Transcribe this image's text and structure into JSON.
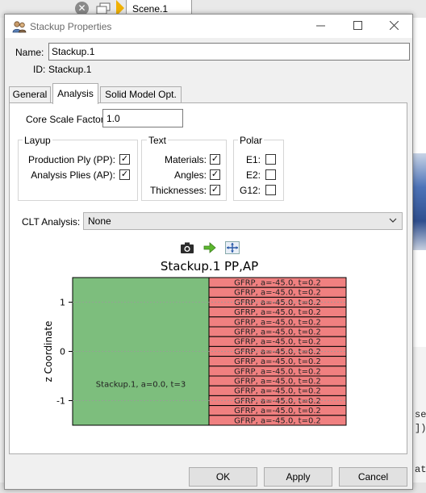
{
  "background": {
    "tab_label": "Scene.1",
    "code_text_1": "se",
    "code_text_2": "])",
    "code_text_3": "at"
  },
  "dialog": {
    "title": "Stackup Properties",
    "window_controls": [
      "minimize-icon",
      "maximize-icon",
      "close-icon"
    ]
  },
  "name": {
    "label": "Name:",
    "value": "Stackup.1"
  },
  "id": {
    "label": "ID:",
    "value": "Stackup.1"
  },
  "tabs": [
    {
      "label": "General"
    },
    {
      "label": "Analysis"
    },
    {
      "label": "Solid Model Opt."
    }
  ],
  "active_tab": "Analysis",
  "core_scale": {
    "label": "Core Scale Factor:",
    "value": "1.0"
  },
  "layup": {
    "title": "Layup",
    "items": [
      {
        "label": "Production Ply (PP):",
        "checked": true
      },
      {
        "label": "Analysis Plies (AP):",
        "checked": true
      }
    ]
  },
  "text_group": {
    "title": "Text",
    "items": [
      {
        "label": "Materials:",
        "checked": true
      },
      {
        "label": "Angles:",
        "checked": true
      },
      {
        "label": "Thicknesses:",
        "checked": true
      }
    ]
  },
  "polar": {
    "title": "Polar",
    "items": [
      {
        "label": "E1:",
        "checked": false
      },
      {
        "label": "E2:",
        "checked": false
      },
      {
        "label": "G12:",
        "checked": false
      }
    ]
  },
  "clt": {
    "label": "CLT Analysis:",
    "value": "None"
  },
  "plot_toolbar": [
    "camera-icon",
    "arrow-right-icon",
    "fit-view-icon"
  ],
  "chart_data": {
    "type": "bar",
    "title": "Stackup.1 PP,AP",
    "xlabel": "",
    "ylabel": "z Coordinate",
    "ylim": [
      -1.5,
      1.5
    ],
    "y_ticks": [
      "1",
      "0",
      "-1"
    ],
    "y_tick_values": [
      1,
      0,
      -1
    ],
    "grid": "horizontal dashed",
    "production_ply": {
      "label": "Stackup.1, a=0.0, t=3",
      "z_range": [
        -1.5,
        1.5
      ],
      "color": "#7dbe7d"
    },
    "analysis_plies": {
      "color": "#f08080",
      "labels": [
        "GFRP, a=-45.0, t=0.2",
        "GFRP, a=-45.0, t=0.2",
        "GFRP, a=-45.0, t=0.2",
        "GFRP, a=-45.0, t=0.2",
        "GFRP, a=-45.0, t=0.2",
        "GFRP, a=-45.0, t=0.2",
        "GFRP, a=-45.0, t=0.2",
        "GFRP, a=-45.0, t=0.2",
        "GFRP, a=-45.0, t=0.2",
        "GFRP, a=-45.0, t=0.2",
        "GFRP, a=-45.0, t=0.2",
        "GFRP, a=-45.0, t=0.2",
        "GFRP, a=-45.0, t=0.2",
        "GFRP, a=-45.0, t=0.2",
        "GFRP, a=-45.0, t=0.2"
      ],
      "thickness": 0.2
    }
  },
  "buttons": {
    "ok": "OK",
    "apply": "Apply",
    "cancel": "Cancel"
  }
}
